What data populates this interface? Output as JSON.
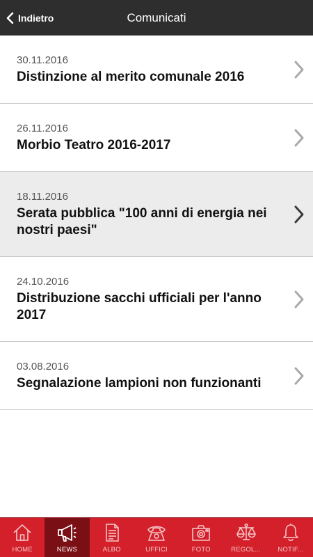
{
  "header": {
    "back_label": "Indietro",
    "title": "Comunicati"
  },
  "news": [
    {
      "date": "30.11.2016",
      "title": "Distinzione al merito comunale 2016"
    },
    {
      "date": "26.11.2016",
      "title": "Morbio Teatro 2016-2017"
    },
    {
      "date": "18.11.2016",
      "title": "Serata pubblica \"100 anni di energia nei nostri paesi\""
    },
    {
      "date": "24.10.2016",
      "title": "Distribuzione sacchi ufficiali per l'anno 2017"
    },
    {
      "date": "03.08.2016",
      "title": "Segnalazione lampioni non funzionanti"
    }
  ],
  "selected_index": 2,
  "tabs": [
    {
      "label": "HOME",
      "icon": "home-icon"
    },
    {
      "label": "NEWS",
      "icon": "megaphone-icon"
    },
    {
      "label": "ALBO",
      "icon": "document-icon"
    },
    {
      "label": "UFFICI",
      "icon": "telephone-icon"
    },
    {
      "label": "FOTO",
      "icon": "camera-icon"
    },
    {
      "label": "REGOL...",
      "icon": "scales-icon"
    },
    {
      "label": "NOTIF...",
      "icon": "bell-icon"
    }
  ],
  "active_tab": 1,
  "colors": {
    "header_bg": "#2e2e2e",
    "tabbar_bg": "#d4202a",
    "tab_active_bg": "#7a1016",
    "selected_row_bg": "#ececec"
  }
}
